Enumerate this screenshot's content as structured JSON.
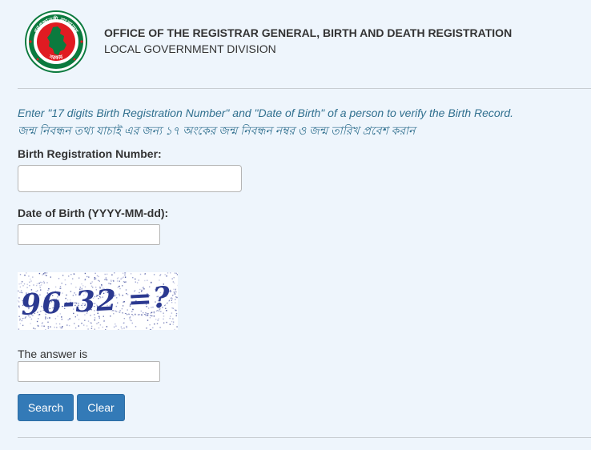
{
  "header": {
    "logo_icon": "government-seal-icon",
    "logo_text_top": "গণপ্রজাতন্ত্রী বাংলাদেশ",
    "logo_text_bottom": "সরকার",
    "title": "OFFICE OF THE REGISTRAR GENERAL, BIRTH AND DEATH REGISTRATION",
    "subtitle": "LOCAL GOVERNMENT DIVISION"
  },
  "instructions": {
    "english": "Enter \"17 digits Birth Registration Number\" and \"Date of Birth\" of a person to verify the Birth Record.",
    "bangla": "জন্ম নিবন্ধন তথ্য যাচাই এর জন্য ১৭ অংকের জন্ম নিবন্ধন নম্বর ও জন্ম তারিখ প্রবেশ করান"
  },
  "form": {
    "brn_label": "Birth Registration Number:",
    "brn_value": "",
    "dob_label": "Date of Birth (YYYY-MM-dd):",
    "dob_value": "",
    "captcha_text": "96-32 =?",
    "answer_label": "The answer is",
    "answer_value": ""
  },
  "buttons": {
    "search_label": "Search",
    "clear_label": "Clear"
  },
  "colors": {
    "background": "#eef5fc",
    "instruction_text": "#31708f",
    "button": "#337ab7",
    "seal_red": "#e01b22",
    "seal_green": "#0b7a3e",
    "captcha_ink": "#2b3990"
  }
}
